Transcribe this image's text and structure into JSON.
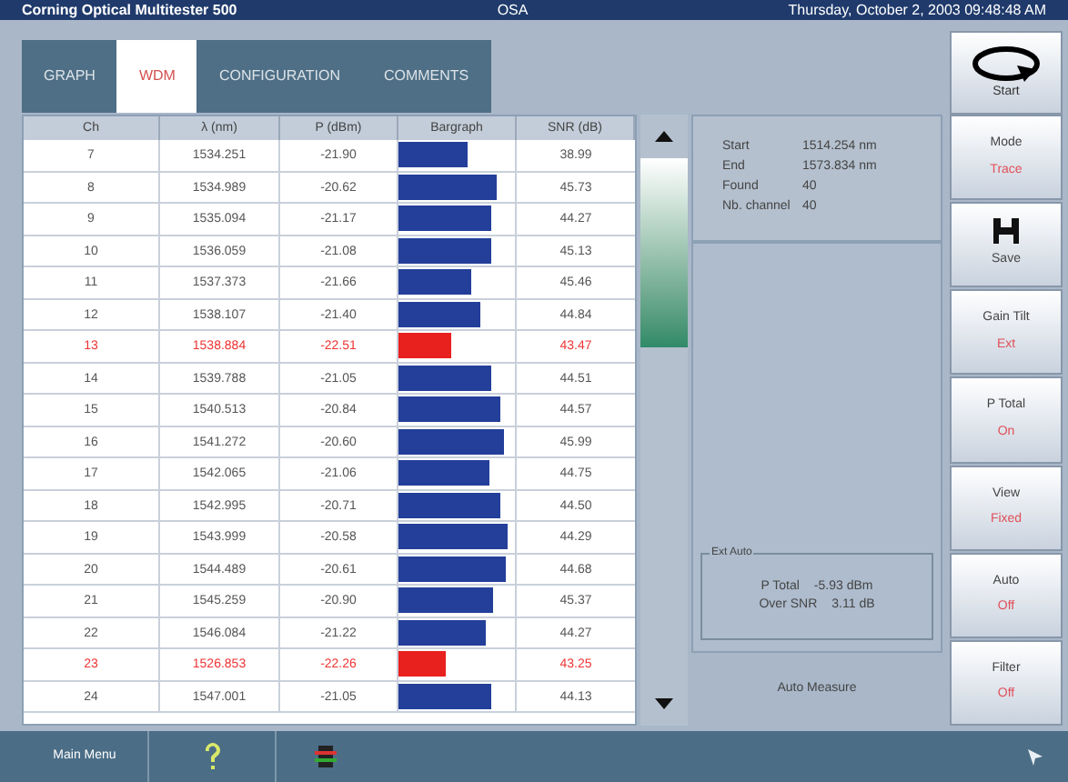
{
  "title_bar": {
    "title": "Corning Optical Multitester 500",
    "mode": "OSA",
    "datetime": "Thursday, October 2, 2003 09:48:48 AM"
  },
  "tabs": [
    {
      "label": "GRAPH",
      "selected": false
    },
    {
      "label": "WDM",
      "selected": true
    },
    {
      "label": "CONFIGURATION",
      "selected": false
    },
    {
      "label": "COMMENTS",
      "selected": false
    }
  ],
  "start_button": {
    "label": "Start"
  },
  "table": {
    "columns": [
      "Ch",
      "λ (nm)",
      "P (dBm)",
      "Bargraph",
      "SNR (dB)"
    ],
    "rows": [
      {
        "ch": "7",
        "wavelength": "1534.251",
        "power": "-21.90",
        "level": 0.6,
        "snr": "38.99",
        "alarm": false
      },
      {
        "ch": "8",
        "wavelength": "1534.989",
        "power": "-20.62",
        "level": 0.85,
        "snr": "45.73",
        "alarm": false
      },
      {
        "ch": "9",
        "wavelength": "1535.094",
        "power": "-21.17",
        "level": 0.8,
        "snr": "44.27",
        "alarm": false
      },
      {
        "ch": "10",
        "wavelength": "1536.059",
        "power": "-21.08",
        "level": 0.8,
        "snr": "45.13",
        "alarm": false
      },
      {
        "ch": "11",
        "wavelength": "1537.373",
        "power": "-21.66",
        "level": 0.62,
        "snr": "45.46",
        "alarm": false
      },
      {
        "ch": "12",
        "wavelength": "1538.107",
        "power": "-21.40",
        "level": 0.7,
        "snr": "44.84",
        "alarm": false
      },
      {
        "ch": "13",
        "wavelength": "1538.884",
        "power": "-22.51",
        "level": 0.45,
        "snr": "43.47",
        "alarm": true
      },
      {
        "ch": "14",
        "wavelength": "1539.788",
        "power": "-21.05",
        "level": 0.8,
        "snr": "44.51",
        "alarm": false
      },
      {
        "ch": "15",
        "wavelength": "1540.513",
        "power": "-20.84",
        "level": 0.87,
        "snr": "44.57",
        "alarm": false
      },
      {
        "ch": "16",
        "wavelength": "1541.272",
        "power": "-20.60",
        "level": 0.9,
        "snr": "45.99",
        "alarm": false
      },
      {
        "ch": "17",
        "wavelength": "1542.065",
        "power": "-21.06",
        "level": 0.78,
        "snr": "44.75",
        "alarm": false
      },
      {
        "ch": "18",
        "wavelength": "1542.995",
        "power": "-20.71",
        "level": 0.88,
        "snr": "44.50",
        "alarm": false
      },
      {
        "ch": "19",
        "wavelength": "1543.999",
        "power": "-20.58",
        "level": 0.93,
        "snr": "44.29",
        "alarm": false
      },
      {
        "ch": "20",
        "wavelength": "1544.489",
        "power": "-20.61",
        "level": 0.92,
        "snr": "44.68",
        "alarm": false
      },
      {
        "ch": "21",
        "wavelength": "1545.259",
        "power": "-20.90",
        "level": 0.82,
        "snr": "45.37",
        "alarm": false
      },
      {
        "ch": "22",
        "wavelength": "1546.084",
        "power": "-21.22",
        "level": 0.75,
        "snr": "44.27",
        "alarm": false
      },
      {
        "ch": "23",
        "wavelength": "1526.853",
        "power": "-22.26",
        "level": 0.4,
        "snr": "43.25",
        "alarm": true
      },
      {
        "ch": "24",
        "wavelength": "1547.001",
        "power": "-21.05",
        "level": 0.8,
        "snr": "44.13",
        "alarm": false
      }
    ]
  },
  "info": [
    {
      "label": "Start",
      "value": "1514.254 nm"
    },
    {
      "label": "End",
      "value": "1573.834 nm"
    },
    {
      "label": "Found",
      "value": "40"
    },
    {
      "label": "Nb. channel",
      "value": "40"
    }
  ],
  "summary": {
    "title": "Ext Auto",
    "items": [
      {
        "label": "P Total",
        "value": "-5.93 dBm"
      },
      {
        "label": "Over SNR",
        "value": "3.11 dB"
      }
    ]
  },
  "status": "Auto Measure",
  "side_buttons": [
    {
      "label": "Mode",
      "value": "Trace",
      "kind": "text"
    },
    {
      "label": "Save",
      "kind": "save"
    },
    {
      "label": "Gain Tilt",
      "value": "Ext",
      "kind": "text"
    },
    {
      "label": "P Total",
      "value": "On",
      "kind": "text"
    },
    {
      "label": "View",
      "value": "Fixed",
      "kind": "text"
    },
    {
      "label": "Auto",
      "value": "Off",
      "kind": "text"
    },
    {
      "label": "Filter",
      "value": "Off",
      "kind": "text"
    }
  ],
  "bottom_bar": {
    "main_menu": "Main Menu"
  }
}
